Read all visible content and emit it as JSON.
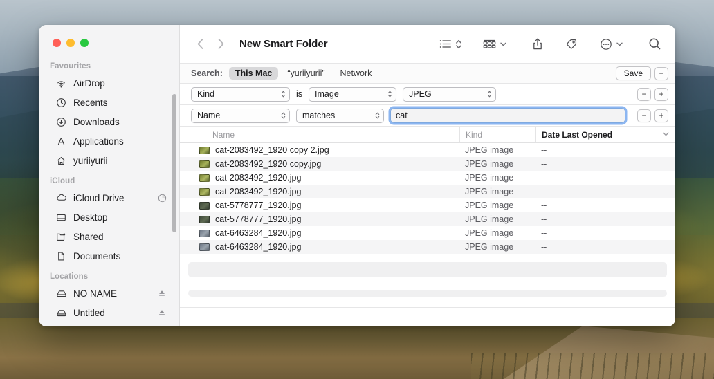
{
  "window": {
    "title": "New Smart Folder",
    "traffic_lights": [
      "close",
      "minimize",
      "zoom"
    ]
  },
  "toolbar": {
    "back_icon": "chevron-left-icon",
    "forward_icon": "chevron-right-icon",
    "view_list_icon": "list-view-icon",
    "view_sort_icon": "updown-chevron-icon",
    "group_icon": "group-by-icon",
    "group_chevron_icon": "chevron-down-icon",
    "share_icon": "share-icon",
    "tag_icon": "tag-icon",
    "more_icon": "ellipsis-circle-icon",
    "more_chevron_icon": "chevron-down-icon",
    "search_icon": "search-icon"
  },
  "sidebar": {
    "sections": [
      {
        "title": "Favourites",
        "items": [
          {
            "label": "AirDrop",
            "icon": "airdrop-icon"
          },
          {
            "label": "Recents",
            "icon": "clock-icon"
          },
          {
            "label": "Downloads",
            "icon": "download-icon"
          },
          {
            "label": "Applications",
            "icon": "applications-icon"
          },
          {
            "label": "yuriiyurii",
            "icon": "home-icon"
          }
        ]
      },
      {
        "title": "iCloud",
        "items": [
          {
            "label": "iCloud Drive",
            "icon": "cloud-icon",
            "trailing": "progress-icon"
          },
          {
            "label": "Desktop",
            "icon": "desktop-icon"
          },
          {
            "label": "Shared",
            "icon": "shared-folder-icon"
          },
          {
            "label": "Documents",
            "icon": "document-icon"
          }
        ]
      },
      {
        "title": "Locations",
        "items": [
          {
            "label": "NO NAME",
            "icon": "drive-icon",
            "trailing": "eject-icon"
          },
          {
            "label": "Untitled",
            "icon": "drive-icon",
            "trailing": "eject-icon"
          }
        ]
      }
    ]
  },
  "search_bar": {
    "label": "Search:",
    "scopes": [
      {
        "label": "This Mac",
        "active": true
      },
      {
        "label": "“yuriiyurii”",
        "active": false
      },
      {
        "label": "Network",
        "active": false
      }
    ],
    "save_label": "Save",
    "remove_label": "−"
  },
  "criteria": [
    {
      "attribute": "Kind",
      "operator_label": "is",
      "value": "Image",
      "subvalue": "JPEG",
      "remove_label": "−",
      "add_label": "+"
    },
    {
      "attribute": "Name",
      "operator": "matches",
      "text_value": "cat",
      "text_placeholder": "",
      "remove_label": "−",
      "add_label": "+",
      "focused": true
    }
  ],
  "columns": [
    {
      "label": "Name",
      "sorted": false
    },
    {
      "label": "Kind",
      "sorted": false
    },
    {
      "label": "Date Last Opened",
      "sorted": true,
      "sort_icon": "chevron-down-icon"
    }
  ],
  "files": [
    {
      "name": "cat-2083492_1920 copy 2.jpg",
      "kind": "JPEG image",
      "date": "--",
      "thumb": "#8c9a3c"
    },
    {
      "name": "cat-2083492_1920 copy.jpg",
      "kind": "JPEG image",
      "date": "--",
      "thumb": "#8c9a3c"
    },
    {
      "name": "cat-2083492_1920.jpg",
      "kind": "JPEG image",
      "date": "--",
      "thumb": "#94a048"
    },
    {
      "name": "cat-2083492_1920.jpg",
      "kind": "JPEG image",
      "date": "--",
      "thumb": "#94a048"
    },
    {
      "name": "cat-5778777_1920.jpg",
      "kind": "JPEG image",
      "date": "--",
      "thumb": "#4a5448"
    },
    {
      "name": "cat-5778777_1920.jpg",
      "kind": "JPEG image",
      "date": "--",
      "thumb": "#4a5448"
    },
    {
      "name": "cat-6463284_1920.jpg",
      "kind": "JPEG image",
      "date": "--",
      "thumb": "#7b8694"
    },
    {
      "name": "cat-6463284_1920.jpg",
      "kind": "JPEG image",
      "date": "--",
      "thumb": "#7b8694"
    }
  ],
  "colors": {
    "accent_blue": "#2d7ae5",
    "sidebar_bg": "#f4f4f5",
    "row_alt": "#f5f5f6",
    "traffic_red": "#ff5f57",
    "traffic_yellow": "#febc2e",
    "traffic_green": "#28c840"
  }
}
